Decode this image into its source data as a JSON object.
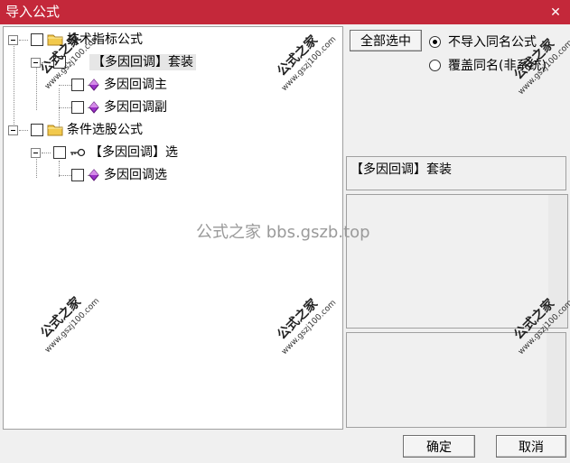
{
  "window": {
    "title": "导入公式",
    "close_glyph": "✕"
  },
  "tree": {
    "items": [
      {
        "label": "技术指标公式",
        "level": 0,
        "icon": "folder-icon"
      },
      {
        "label": "【多因回调】套装",
        "level": 1,
        "icon": "blank-icon",
        "selected": true
      },
      {
        "label": "多因回调主",
        "level": 2,
        "icon": "purple-diamond-icon"
      },
      {
        "label": "多因回调副",
        "level": 2,
        "icon": "purple-diamond-icon"
      },
      {
        "label": "条件选股公式",
        "level": 0,
        "icon": "folder-icon"
      },
      {
        "label": "【多因回调】选",
        "level": 1,
        "icon": "key-icon"
      },
      {
        "label": "多因回调选",
        "level": 2,
        "icon": "purple-diamond-icon"
      }
    ]
  },
  "options": {
    "select_all_label": "全部选中",
    "radio_skip_label": "不导入同名公式",
    "radio_overwrite_label": "覆盖同名(非系统)"
  },
  "info": {
    "selected_name": "【多因回调】套装"
  },
  "footer": {
    "ok_label": "确定",
    "cancel_label": "取消"
  },
  "watermark": {
    "cn": "公式之家",
    "url": "www.gszj100.com",
    "center": "公式之家 bbs.gszb.top"
  },
  "colors": {
    "titlebar": "#c4283a",
    "folder": "#f2c94c",
    "diamond": "#9b30c8"
  }
}
